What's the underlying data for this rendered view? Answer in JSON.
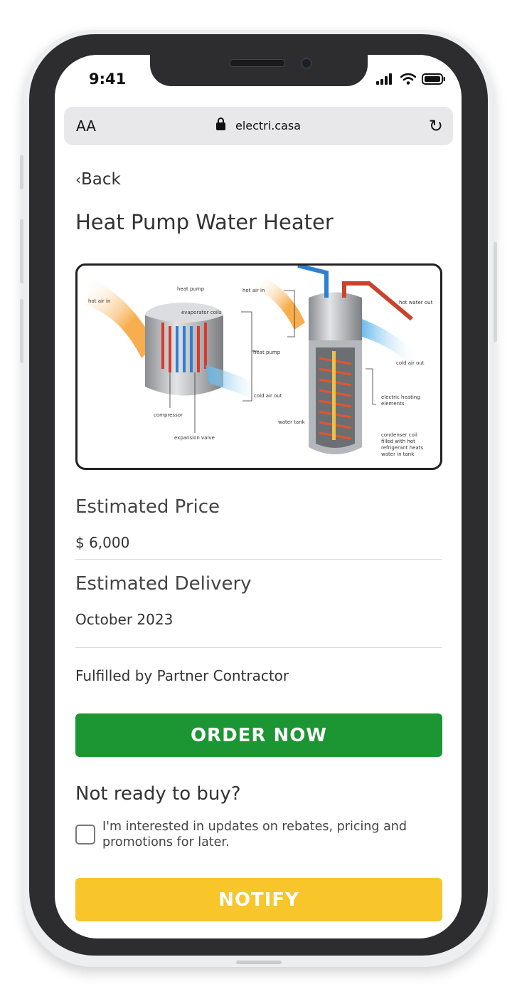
{
  "status_bar": {
    "time": "9:41",
    "icons": [
      "cellular-signal-icon",
      "wifi-icon",
      "battery-icon"
    ]
  },
  "browser": {
    "text_size_label": "AA",
    "url": "electri.casa",
    "lock_icon": "lock-icon",
    "reload_icon": "reload-icon"
  },
  "nav": {
    "back_label": "Back"
  },
  "product": {
    "title": "Heat Pump Water Heater",
    "diagram_labels": {
      "hot_air_in_left": "hot air in",
      "heat_pump_top": "heat pump",
      "evaporator_coils": "evaporator coils",
      "compressor": "compressor",
      "expansion_valve": "expansion valve",
      "cold_air_out_left": "cold air out",
      "heat_pump_mid": "heat pump",
      "hot_air_in_right": "hot air in",
      "hot_water_out": "hot water out",
      "cold_air_out_right": "cold air out",
      "electric_heating_elements": "electric heating elements",
      "water_tank": "water tank",
      "condenser_coil": "condenser coil filled with hot refrigerant heats water in tank"
    }
  },
  "price": {
    "label": "Estimated Price",
    "value": "$ 6,000"
  },
  "delivery": {
    "label": "Estimated Delivery",
    "value": "October 2023"
  },
  "fulfilled_text": "Fulfilled by Partner Contractor",
  "order_button_label": "ORDER NOW",
  "not_ready": {
    "heading": "Not ready to buy?",
    "checkbox_label": "I'm interested in updates on rebates, pricing and promotions for later.",
    "checked": false
  },
  "notify_button_label": "NOTIFY",
  "colors": {
    "order_green": "#1b9632",
    "notify_yellow": "#f8c52a",
    "hot_orange": "#f7a43b",
    "cold_blue": "#5bb4ea"
  }
}
